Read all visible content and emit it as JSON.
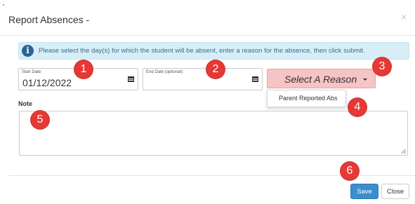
{
  "dialog": {
    "title": "Report Absences -",
    "close_label": "×"
  },
  "info": {
    "icon": "info-icon",
    "icon_glyph": "i",
    "message": "Please select the day(s) for which the student will be absent, enter a reason for the absence, then click submit."
  },
  "start_date": {
    "label": "Start Date:",
    "value": "01/12/2022",
    "icon": "calendar-icon"
  },
  "end_date": {
    "label": "End Date (optional):",
    "value": "",
    "icon": "calendar-icon"
  },
  "reason": {
    "label": "Select A Reason",
    "options": [
      "Parent Reported Abs"
    ]
  },
  "note": {
    "label": "Note",
    "value": ""
  },
  "footer": {
    "save_label": "Save",
    "close_label": "Close"
  },
  "markers": [
    "1",
    "2",
    "3",
    "4",
    "5",
    "6"
  ],
  "colors": {
    "info_bg": "#d9edf7",
    "info_text": "#31708f",
    "reason_bg": "#f6c4c4",
    "save_bg": "#3c8dcb",
    "marker_red": "#e53935"
  }
}
